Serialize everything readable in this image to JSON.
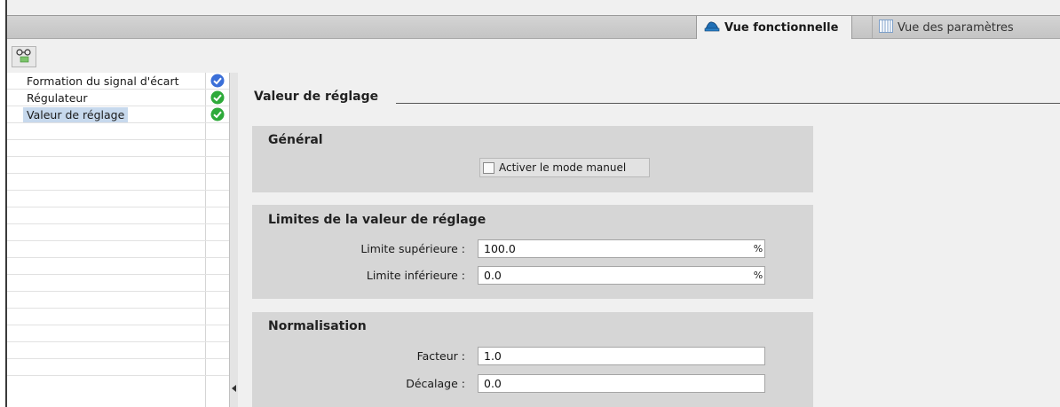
{
  "tabs": {
    "functional_view": "Vue fonctionnelle",
    "parameter_view": "Vue des paramètres"
  },
  "toolbar": {
    "button_icon": "glasses-icon"
  },
  "nav": {
    "items": [
      {
        "label": "Formation du signal d'écart",
        "status": "check-blue"
      },
      {
        "label": "Régulateur",
        "status": "check-green"
      },
      {
        "label": "Valeur de réglage",
        "status": "check-green",
        "selected": true
      }
    ]
  },
  "section": {
    "title": "Valeur de réglage"
  },
  "general": {
    "title": "Général",
    "manual_mode_label": "Activer le mode manuel",
    "manual_mode_checked": false
  },
  "limits": {
    "title": "Limites de la valeur de réglage",
    "upper_label": "Limite supérieure :",
    "upper_value": "100.0",
    "upper_unit": "%",
    "lower_label": "Limite inférieure :",
    "lower_value": "0.0",
    "lower_unit": "%"
  },
  "normalization": {
    "title": "Normalisation",
    "factor_label": "Facteur :",
    "factor_value": "1.0",
    "offset_label": "Décalage :",
    "offset_value": "0.0"
  },
  "colors": {
    "status_green": "#2eaa3a",
    "status_blue": "#3b6fd8",
    "selected_bg": "#c7d9ed"
  }
}
